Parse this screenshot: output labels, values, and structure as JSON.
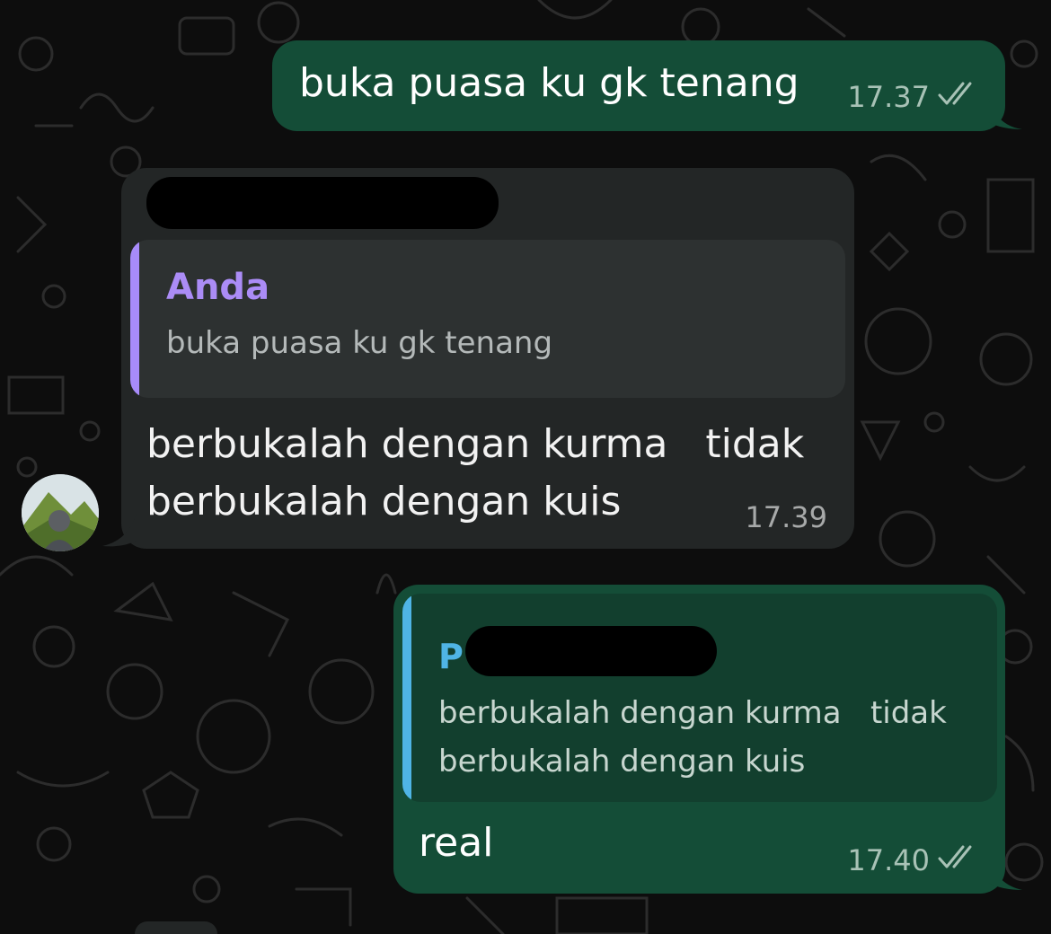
{
  "messages": [
    {
      "direction": "outgoing",
      "text": "buka puasa ku gk tenang",
      "time": "17.37",
      "status": "read"
    },
    {
      "direction": "incoming",
      "sender_redacted": true,
      "quote": {
        "author": "Anda",
        "text": "buka puasa ku gk tenang"
      },
      "text_line1": "berbukalah dengan kurma   tidak",
      "text_line2": "berbukalah dengan kuis",
      "time": "17.39"
    },
    {
      "direction": "outgoing",
      "quote": {
        "author_initial": "P",
        "author_redacted": true,
        "text_line1": "berbukalah dengan kurma   tidak",
        "text_line2": "berbukalah dengan kuis"
      },
      "text": "real",
      "time": "17.40",
      "status": "read"
    }
  ],
  "colors": {
    "outgoing_bubble": "#144d37",
    "incoming_bubble": "#232626",
    "quote_author_self": "#ab8cf6",
    "quote_author_other": "#4fb4e5"
  },
  "icons": {
    "read_receipt": "double-check-icon",
    "avatar": "contact-avatar"
  }
}
